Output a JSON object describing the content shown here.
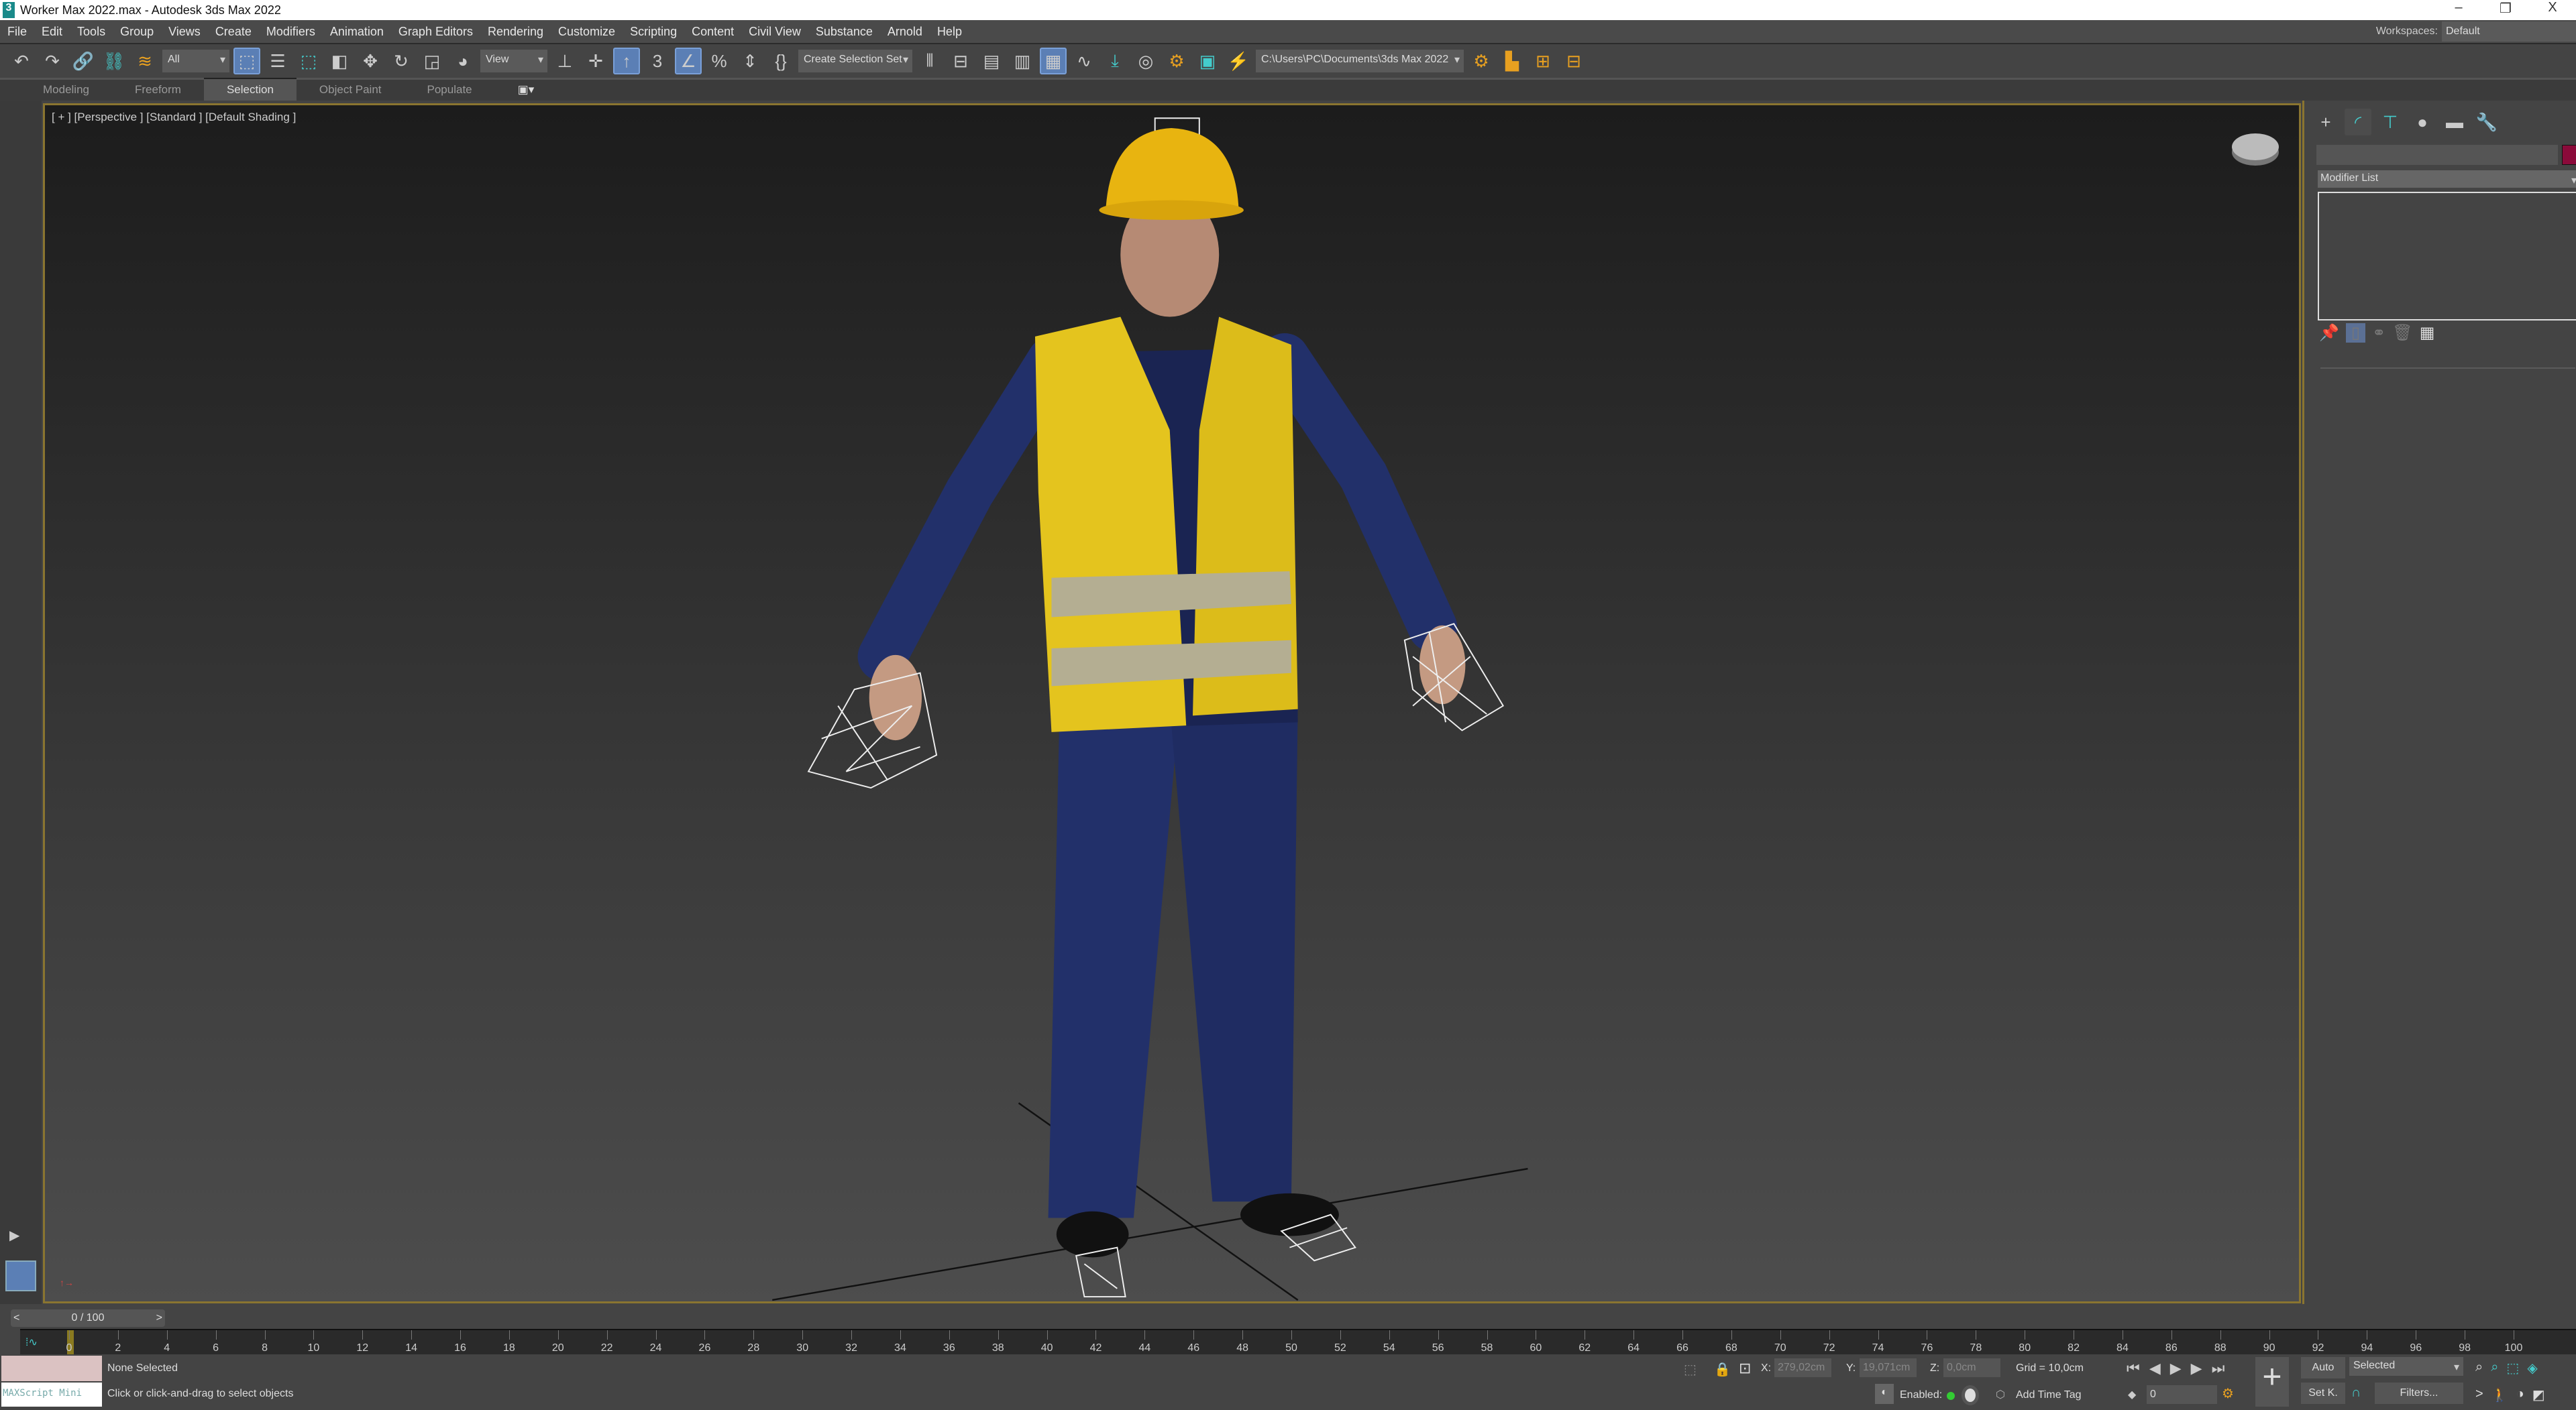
{
  "window": {
    "title": "Worker Max 2022.max - Autodesk 3ds Max 2022",
    "logo": "3",
    "minimize": "–",
    "restore": "❐",
    "close": "X"
  },
  "menu": [
    "File",
    "Edit",
    "Tools",
    "Group",
    "Views",
    "Create",
    "Modifiers",
    "Animation",
    "Graph Editors",
    "Rendering",
    "Customize",
    "Scripting",
    "Content",
    "Civil View",
    "Substance",
    "Arnold",
    "Help"
  ],
  "workspaces": {
    "label": "Workspaces:",
    "value": "Default"
  },
  "toolbar": {
    "filter": "All",
    "ref_coord": "View",
    "selection_set": "Create Selection Set",
    "project_path": "C:\\Users\\PC\\Documents\\3ds Max 2022",
    "snap_3": "3"
  },
  "ribbon": {
    "tabs": [
      "Modeling",
      "Freeform",
      "Selection",
      "Object Paint",
      "Populate"
    ],
    "active": "Selection"
  },
  "viewport": {
    "label": "[ + ] [Perspective ]  [Standard ] [Default Shading ]"
  },
  "command_panel": {
    "modifier_list": "Modifier List",
    "object_color": "#8b0a3a"
  },
  "time_slider": {
    "value": "0 / 100",
    "prev": "<",
    "next": ">"
  },
  "timeline": {
    "labels": [
      "0",
      "2",
      "4",
      "6",
      "8",
      "10",
      "12",
      "14",
      "16",
      "18",
      "20",
      "22",
      "24",
      "26",
      "28",
      "30",
      "32",
      "34",
      "36",
      "38",
      "40",
      "42",
      "44",
      "46",
      "48",
      "50",
      "52",
      "54",
      "56",
      "58",
      "60",
      "62",
      "64",
      "66",
      "68",
      "70",
      "72",
      "74",
      "76",
      "78",
      "80",
      "82",
      "84",
      "86",
      "88",
      "90",
      "92",
      "94",
      "96",
      "98",
      "100"
    ]
  },
  "status": {
    "selection": "None Selected",
    "prompt": "Click or click-and-drag to select objects",
    "maxscript": "MAXScript Mini",
    "x_label": "X:",
    "x": "279,02cm",
    "y_label": "Y:",
    "y": "19,071cm",
    "z_label": "Z:",
    "z": "0,0cm",
    "grid": "Grid = 10,0cm",
    "enabled": "Enabled:",
    "add_time_tag": "Add Time Tag",
    "frame": "0",
    "auto": "Auto",
    "set_key": "Set K.",
    "key_filter": "Selected",
    "filters": "Filters..."
  }
}
